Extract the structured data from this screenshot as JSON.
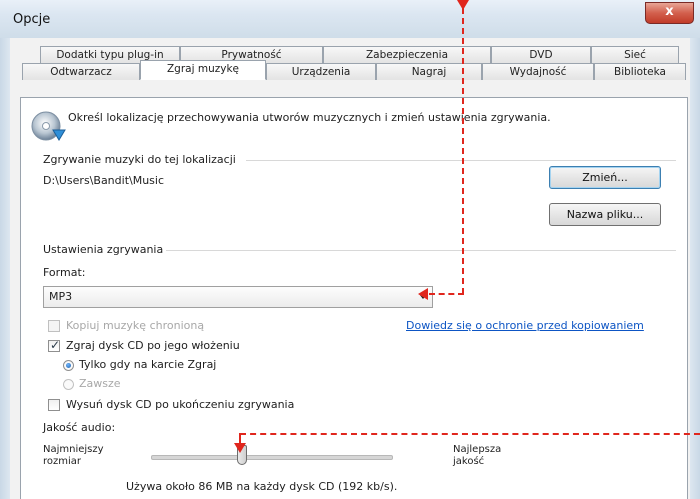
{
  "window": {
    "title": "Opcje",
    "close_symbol": "x"
  },
  "tabs_row1": [
    "Dodatki typu plug-in",
    "Prywatność",
    "Zabezpieczenia",
    "DVD",
    "Sieć"
  ],
  "tabs_row2": [
    "Odtwarzacz",
    "Zgraj muzykę",
    "Urządzenia",
    "Nagraj",
    "Wydajność",
    "Biblioteka"
  ],
  "active_tab": "Zgraj muzykę",
  "intro_text": "Określ lokalizację przechowywania utworów muzycznych i zmień ustawienia zgrywania.",
  "location": {
    "heading": "Zgrywanie muzyki do tej lokalizacji",
    "path": "D:\\Users\\Bandit\\Music",
    "change_button": "Zmień...",
    "filename_button": "Nazwa pliku..."
  },
  "rip_settings": {
    "heading": "Ustawienia zgrywania",
    "format_label": "Format:",
    "format_value": "MP3",
    "copy_protect_label": "Kopiuj muzykę chronioną",
    "copy_protect_link": "Dowiedz się o ochronie przed kopiowaniem",
    "rip_cd_label": "Zgraj dysk CD po jego włożeniu",
    "radio_only_tab": "Tylko gdy na karcie Zgraj",
    "radio_always": "Zawsze",
    "eject_label": "Wysuń dysk CD po ukończeniu zgrywania"
  },
  "audio_quality": {
    "label": "Jakość audio:",
    "min_label_line1": "Najmniejszy",
    "min_label_line2": "rozmiar",
    "max_label_line1": "Najlepsza",
    "max_label_line2": "jakość",
    "slider_value": 0.38,
    "usage_text": "Używa około 86 MB na każdy dysk CD (192 kb/s)."
  },
  "colors": {
    "annotation": "#e0261d",
    "link": "#0d55c4",
    "title_bg": "#dbe6f1"
  }
}
